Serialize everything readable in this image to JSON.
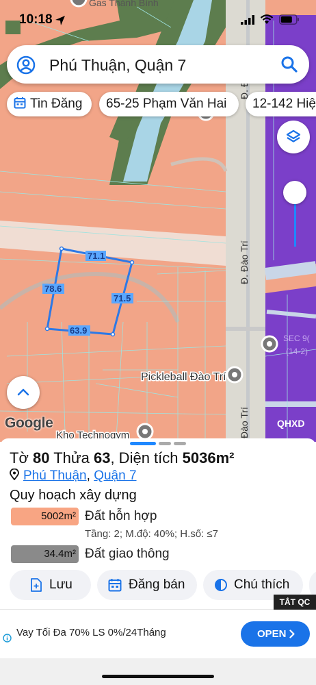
{
  "status": {
    "time": "10:18"
  },
  "search": {
    "text": "Phú Thuận, Quận 7"
  },
  "chips": [
    {
      "label": "Tin Đăng"
    },
    {
      "label": "65-25 Phạm Văn Hai"
    },
    {
      "label": "12-142 Hiệ"
    }
  ],
  "map": {
    "top_poi": "Gas Thành Bình",
    "street_label_1": "Đ. Đào Trí",
    "street_label_top": "Đ. Đ",
    "street_label_bottom": "Đào Trí",
    "poi_pickleball": "Pickleball Đào Trí",
    "poi_kho": "Kho Technogym",
    "poi_right_1": "SEC 9(",
    "poi_right_2": "(14-2)",
    "google_label": "Google",
    "qhxd_label": "QHXD",
    "parcel_edges": {
      "top": "71.1",
      "left": "78.6",
      "right": "71.5",
      "bottom": "63.9"
    }
  },
  "sheet": {
    "title_prefix": "Tờ",
    "to_number": "80",
    "thua_label": "Thửa",
    "thua_number": "63",
    "area_label": ", Diện tích",
    "area_value": "5036m²",
    "ward_link": "Phú Thuận",
    "district_link": "Quận 7",
    "location_sep": ",",
    "heading": "Quy hoạch xây dựng",
    "plans": [
      {
        "area": "5002m²",
        "name": "Đất hỗn hợp",
        "detail": "Tầng: 2; M.độ: 40%; H.số: ≤7",
        "color": "#f8a583"
      },
      {
        "area": "34.4m²",
        "name": "Đất giao thông",
        "detail": "",
        "color": "#8a8a8a"
      }
    ],
    "actions": {
      "save": "Lưu",
      "post": "Đăng bán",
      "legend": "Chú thích"
    }
  },
  "ad": {
    "close_label": "TẮT QC",
    "text": "Vay Tối Đa 70% LS 0%/24Tháng",
    "open_label": "OPEN"
  },
  "colors": {
    "plan_orange": "#f2a588",
    "park_green": "#5d7d4e",
    "water_blue": "#a9d5e6",
    "purple_zone": "#7b3fc9",
    "road_gray": "#d6d4cc",
    "accent_blue": "#1a73e8"
  }
}
